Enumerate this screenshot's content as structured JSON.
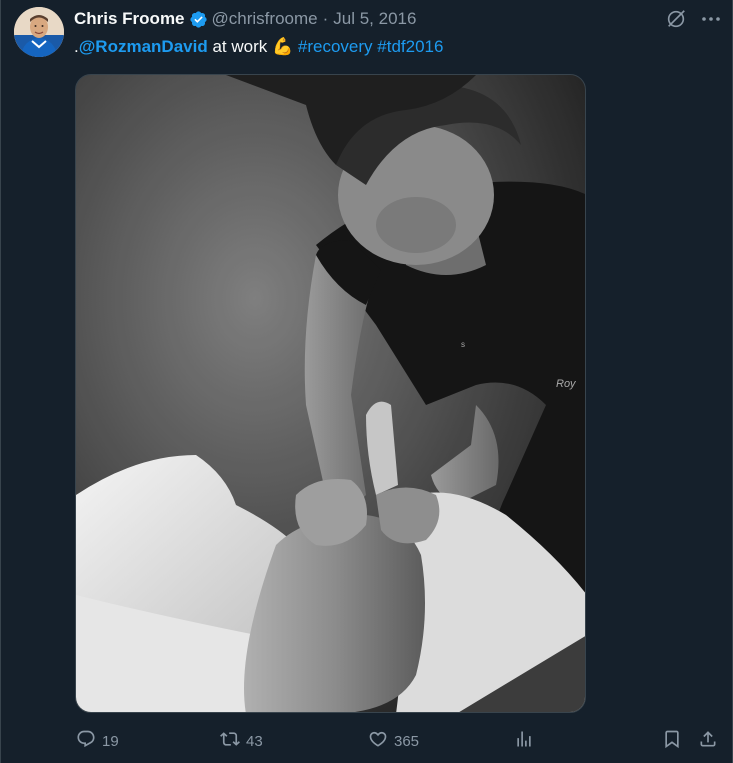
{
  "tweet": {
    "author": {
      "display_name": "Chris Froome",
      "handle": "@chrisfroome",
      "verified": true
    },
    "separator": "·",
    "date": "Jul 5, 2016",
    "text": {
      "prefix": ".",
      "mention": "@RozmanDavid",
      "middle": " at work ",
      "emoji": "💪",
      "hashtags": [
        "#recovery",
        "#tdf2016"
      ]
    },
    "media": {
      "type": "photo",
      "style": "black-and-white"
    },
    "actions": {
      "reply_count": "19",
      "retweet_count": "43",
      "like_count": "365",
      "views_count": ""
    }
  },
  "icons": {
    "verified": "verified-badge-icon",
    "grok": "grok-icon",
    "more": "more-icon",
    "reply": "reply-icon",
    "retweet": "retweet-icon",
    "like": "heart-icon",
    "views": "views-icon",
    "bookmark": "bookmark-icon",
    "share": "share-icon"
  },
  "colors": {
    "background": "#15202b",
    "text": "#f7f9f9",
    "secondary": "#8b98a5",
    "accent": "#1d9bf0"
  }
}
